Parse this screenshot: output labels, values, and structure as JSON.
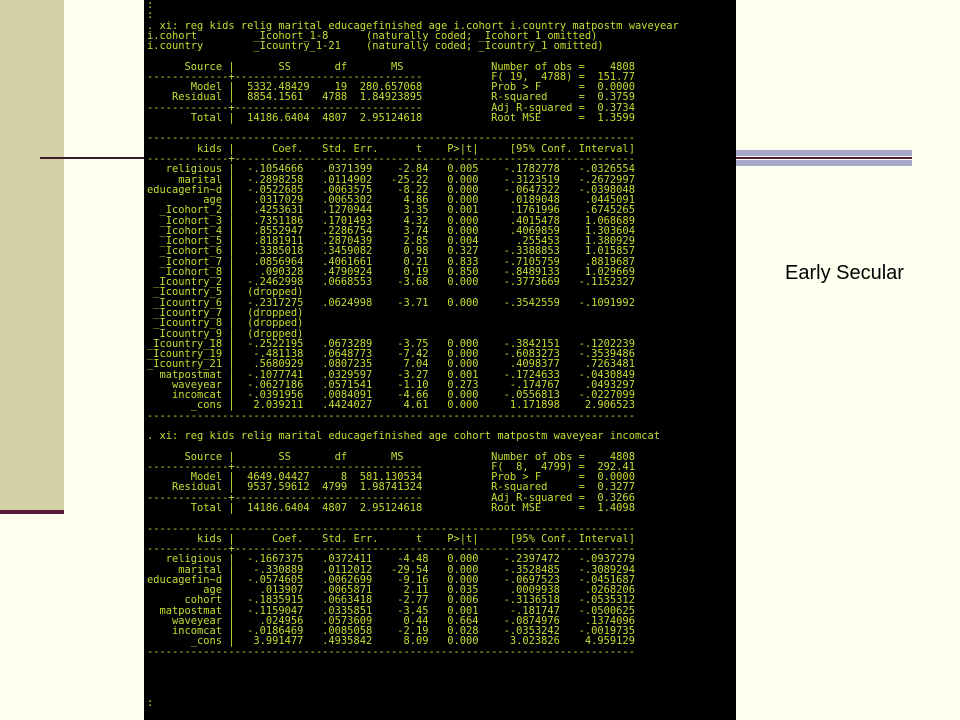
{
  "slide": {
    "label": "Early Secular"
  },
  "terminal_lines": [
    ":",
    ":",
    ". xi: reg kids relig marital educagefinished age i.cohort i.country matpostm waveyear",
    "i.cohort         _Icohort_1-8      (naturally coded; _Icohort_1 omitted)",
    "i.country        _Icountry_1-21    (naturally coded; _Icountry_1 omitted)",
    "",
    "      Source |       SS       df       MS              Number of obs =    4808",
    "-------------+------------------------------           F( 19,  4788) =  151.77",
    "       Model |  5332.48429    19  280.657068           Prob > F      =  0.0000",
    "    Residual |  8854.1561   4788  1.84923895           R-squared     =  0.3759",
    "-------------+------------------------------           Adj R-squared =  0.3734",
    "       Total |  14186.6404  4807  2.95124618           Root MSE      =  1.3599",
    "",
    "------------------------------------------------------------------------------",
    "        kids |      Coef.   Std. Err.      t    P>|t|     [95% Conf. Interval]",
    "-------------+----------------------------------------------------------------",
    "   religious |  -.1054666   .0371399    -2.84   0.005    -.1782778   -.0326554",
    "     marital |  -.2898258   .0114902   -25.22   0.000    -.3123519   -.2672997",
    "educagefin~d |  -.0522685   .0063575    -8.22   0.000    -.0647322   -.0398048",
    "         age |   .0317029   .0065302     4.86   0.000     .0189048    .0445091",
    "  _Icohort_2 |   .4253631   .1270944     3.35   0.001     .1761996    .6745265",
    "  _Icohort_3 |   .7351186   .1701493     4.32   0.000     .4015478    1.068689",
    "  _Icohort_4 |   .8552947   .2286754     3.74   0.000     .4069859    1.303604",
    "  _Icohort_5 |   .8181911   .2870439     2.85   0.004      .255453    1.380929",
    "  _Icohort_6 |   .3385018   .3459082     0.98   0.327    -.3388853    1.015857",
    "  _Icohort_7 |   .0856964   .4061661     0.21   0.833    -.7105759    .8819687",
    "  _Icohort_8 |    .090328   .4790924     0.19   0.850    -.8489133    1.029669",
    " _Icountry_2 |  -.2462998   .0668553    -3.68   0.000    -.3773669   -.1152327",
    " _Icountry_5 |  (dropped)",
    " _Icountry_6 |  -.2317275   .0624998    -3.71   0.000    -.3542559   -.1091992",
    " _Icountry_7 |  (dropped)",
    " _Icountry_8 |  (dropped)",
    " _Icountry_9 |  (dropped)",
    "_Icountry_18 |  -.2522195   .0673289    -3.75   0.000    -.3842151   -.1202239",
    "_Icountry_19 |   -.481138   .0648773    -7.42   0.000    -.6083273   -.3539486",
    "_Icountry_21 |   .5680929   .0807235     7.04   0.000     .4098377    .7263481",
    "  matpostmat |  -.1077741   .0329597    -3.27   0.001    -.1724633   -.0430849",
    "    waveyear |  -.0627186   .0571541    -1.10   0.273     -.174767    .0493297",
    "    incomcat |  -.0391956   .0084091    -4.66   0.000    -.0556813   -.0227099",
    "       _cons |   2.039211   .4424027     4.61   0.000     1.171898    2.906523",
    "------------------------------------------------------------------------------",
    "",
    ". xi: reg kids relig marital educagefinished age cohort matpostm waveyear incomcat",
    "",
    "      Source |       SS       df       MS              Number of obs =    4808",
    "-------------+------------------------------           F(  8,  4799) =  292.41",
    "       Model |  4649.04427     8  581.130534           Prob > F      =  0.0000",
    "    Residual |  9537.59612  4799  1.98741324           R-squared     =  0.3277",
    "-------------+------------------------------           Adj R-squared =  0.3266",
    "       Total |  14186.6404  4807  2.95124618           Root MSE      =  1.4098",
    "",
    "------------------------------------------------------------------------------",
    "        kids |      Coef.   Std. Err.      t    P>|t|     [95% Conf. Interval]",
    "-------------+----------------------------------------------------------------",
    "   religious |  -.1667375   .0372411    -4.48   0.000    -.2397472   -.0937279",
    "     marital |   -.330889   .0112012   -29.54   0.000    -.3528485   -.3089294",
    "educagefin~d |  -.0574605   .0062699    -9.16   0.000    -.0697523   -.0451687",
    "         age |    .013907   .0065871     2.11   0.035     .0009938    .0268206",
    "      cohort |  -.1835915   .0663418    -2.77   0.006    -.3136518   -.0535312",
    "  matpostmat |  -.1159047   .0335851    -3.45   0.001     -.181747   -.0500625",
    "    waveyear |    .024956   .0573609     0.44   0.664    -.0874976    .1374096",
    "    incomcat |  -.0186469   .0085058    -2.19   0.028    -.0353242   -.0019735",
    "       _cons |   3.991477   .4935842     8.09   0.000     3.023826    4.959129",
    "------------------------------------------------------------------------------",
    "",
    "",
    "",
    "",
    ":"
  ]
}
